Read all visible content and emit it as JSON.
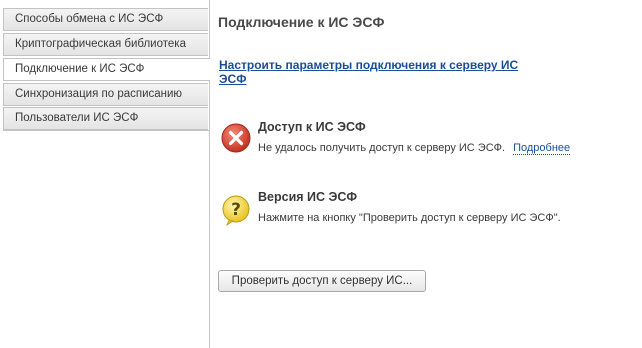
{
  "sidebar": {
    "items": [
      {
        "label": "Способы обмена с ИС ЭСФ",
        "active": false
      },
      {
        "label": "Криптографическая библиотека",
        "active": false
      },
      {
        "label": "Подключение к ИС ЭСФ",
        "active": true
      },
      {
        "label": "Синхронизация по расписанию",
        "active": false
      },
      {
        "label": "Пользователи ИС ЭСФ",
        "active": false
      }
    ]
  },
  "main": {
    "title": "Подключение к ИС ЭСФ",
    "config_link": "Настроить параметры подключения к серверу ИС ЭСФ",
    "access": {
      "icon": "error-icon",
      "title": "Доступ к ИС ЭСФ",
      "text": "Не удалось получить доступ к серверу ИС ЭСФ.",
      "more_link": "Подробнее"
    },
    "version": {
      "icon": "question-icon",
      "title": "Версия ИС ЭСФ",
      "text": "Нажмите на кнопку \"Проверить доступ к серверу ИС ЭСФ\"."
    },
    "check_button": "Проверить доступ к серверу ИС..."
  },
  "colors": {
    "link": "#1a4e99",
    "error": "#d9412e",
    "question": "#f2d33b"
  }
}
